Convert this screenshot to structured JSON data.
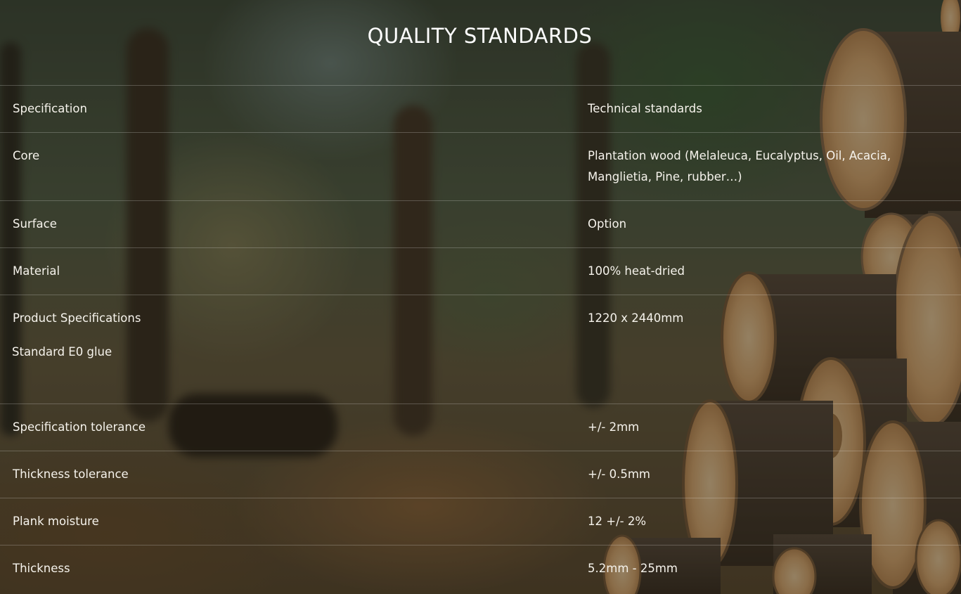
{
  "page": {
    "title": "QUALITY STANDARDS"
  },
  "table": {
    "rows": [
      {
        "label": "Specification",
        "value": "Technical standards"
      },
      {
        "label": "Core",
        "value": "Plantation wood (Melaleuca, Eucalyptus, Oil, Acacia, Manglietia, Pine, rubber…)"
      },
      {
        "label": "Surface",
        "value": "Option"
      },
      {
        "label": "Material",
        "value": "100% heat-dried"
      },
      {
        "label": "Product Specifications",
        "value": "1220 x 2440mm"
      },
      {
        "label": "Standard E0 glue",
        "value": ""
      },
      {
        "label": "Specification tolerance",
        "value": "+/- 2mm"
      },
      {
        "label": "Thickness tolerance",
        "value": "+/- 0.5mm"
      },
      {
        "label": "Plank moisture",
        "value": "12 +/- 2%"
      },
      {
        "label": "Thickness",
        "value": "5.2mm - 25mm"
      }
    ]
  },
  "colors": {
    "text": "#ffffff",
    "divider": "rgba(255,255,255,0.22)",
    "wood_face": "#e2b27a",
    "bark": "#4a3a2c"
  },
  "background": {
    "icon": "forest-log-pile-photo"
  }
}
